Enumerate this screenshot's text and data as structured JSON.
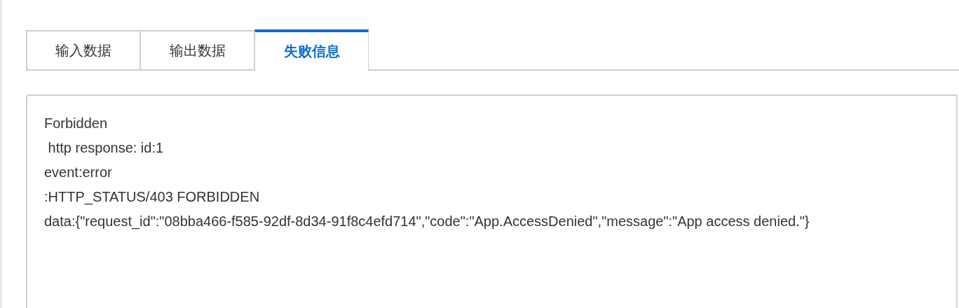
{
  "tabs": [
    {
      "label": "输入数据",
      "selected": false
    },
    {
      "label": "输出数据",
      "selected": false
    },
    {
      "label": "失败信息",
      "selected": true
    }
  ],
  "message": {
    "value": "Forbidden\n http response: id:1\nevent:error\n:HTTP_STATUS/403 FORBIDDEN\ndata:{\"request_id\":\"08bba466-f585-92df-8d34-91f8c4efd714\",\"code\":\"App.AccessDenied\",\"message\":\"App access denied.\"}"
  }
}
